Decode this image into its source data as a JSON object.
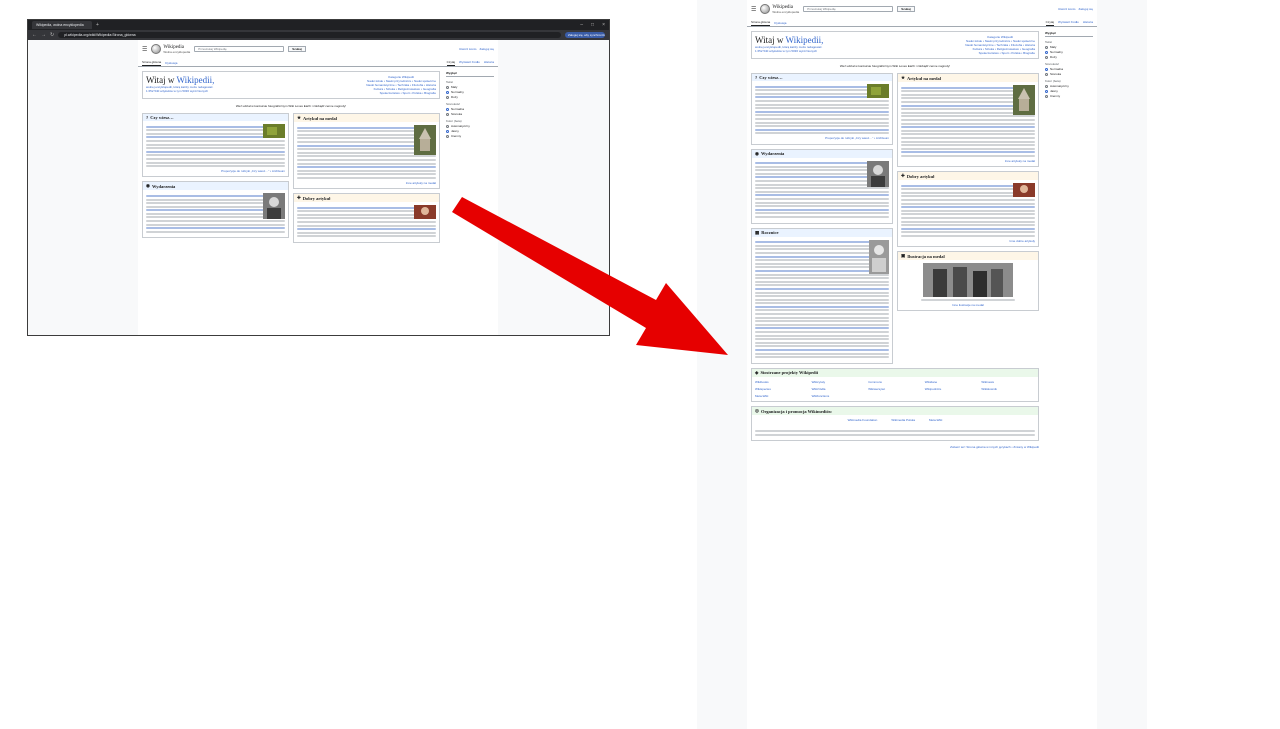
{
  "browser": {
    "tab_title": "Wikipedia, wolna encyklopedia",
    "url": "pl.wikipedia.org/wiki/Wikipedia:Strona_główna",
    "extension_label": "Zaloguj się, aby synchronizować"
  },
  "wiki": {
    "logo_title": "Wikipedia",
    "logo_subtitle": "Wolna encyklopedia",
    "search_placeholder": "Przeszukaj Wikipedię",
    "search_button": "Szukaj",
    "user_links": [
      "Utwórz konto",
      "Zaloguj się"
    ],
    "tabs_left": [
      "Strona główna",
      "Dyskusja"
    ],
    "tabs_right": [
      "Czytaj",
      "Wyświetl źródło",
      "Historia"
    ],
    "welcome_prefix": "Witaj w ",
    "welcome_link": "Wikipedii,",
    "welcome_lines": [
      "wolnej encyklopedii, którą każdy może redagować.",
      "1 652 540 artykułów w tym 5036 wyróżnionych"
    ],
    "portals_head": "Kategorie Wikipedii",
    "portals": [
      "Nauki ścisłe • Nauki przyrodnicze • Nauki społeczne",
      "Nauki humanistyczne • Technika • Filozofia • Historia",
      "Kultura • Sztuka • Religioznawstwo • Geografia",
      "Społeczeństwo • Sport • Polska • Biografie"
    ],
    "notice": "Weź udział w konkursie fotograficznym Wiki Loves Earth i zdobądź cenne nagrody!",
    "sidebar": {
      "title": "Wygląd",
      "hide": "ukryj",
      "groups": [
        {
          "label": "Tekst",
          "options": [
            "Mały",
            "Normalny",
            "Duży"
          ],
          "selected": 1
        },
        {
          "label": "Szerokość",
          "options": [
            "Normalna",
            "Szeroka"
          ],
          "selected": 0
        },
        {
          "label": "Kolor (beta)",
          "options": [
            "Automatyczny",
            "Jasny",
            "Ciemny"
          ],
          "selected": 1
        }
      ]
    },
    "boxes": {
      "did_you_know": "Czy wiesz…",
      "news": "Wydarzenia",
      "featured": "Artykuł na medal",
      "good": "Dobry artykuł",
      "anniversaries": "Rocznice",
      "picture": "Ilustracja na medal",
      "sister": "Siostrzane projekty Wikipedii",
      "org": "Organizacja i promocja Wikimediów"
    },
    "links": {
      "dyk_more": "Propozycje do rubryki „Czy wiesz…” • Archiwum",
      "featured_more": "Inne artykuły na medal",
      "good_more": "Inne dobre artykuły",
      "picture_more": "Inne ilustracje na medal"
    },
    "sister_projects": [
      "Wikibooks",
      "Wikicytaty",
      "Commons",
      "Wikidane",
      "Wikinews",
      "Wikispecies",
      "Wikiźródła",
      "Wikiwersytet",
      "Wikipodróże",
      "Wikisłownik",
      "Meta-Wiki",
      "Wikifunctions"
    ],
    "org_items": [
      "Wikimedia Foundation",
      "Wikimedia Polska",
      "Meta-Wiki"
    ],
    "footer_note": "Zobacz też: Strona główna w innych językach • Zmiany w Wikipedii"
  },
  "colors": {
    "arrow": "#e60000",
    "link": "#3366cc",
    "box_blue": "#eaf3ff",
    "box_yellow": "#fef6e7",
    "box_green": "#eaf8ea"
  }
}
